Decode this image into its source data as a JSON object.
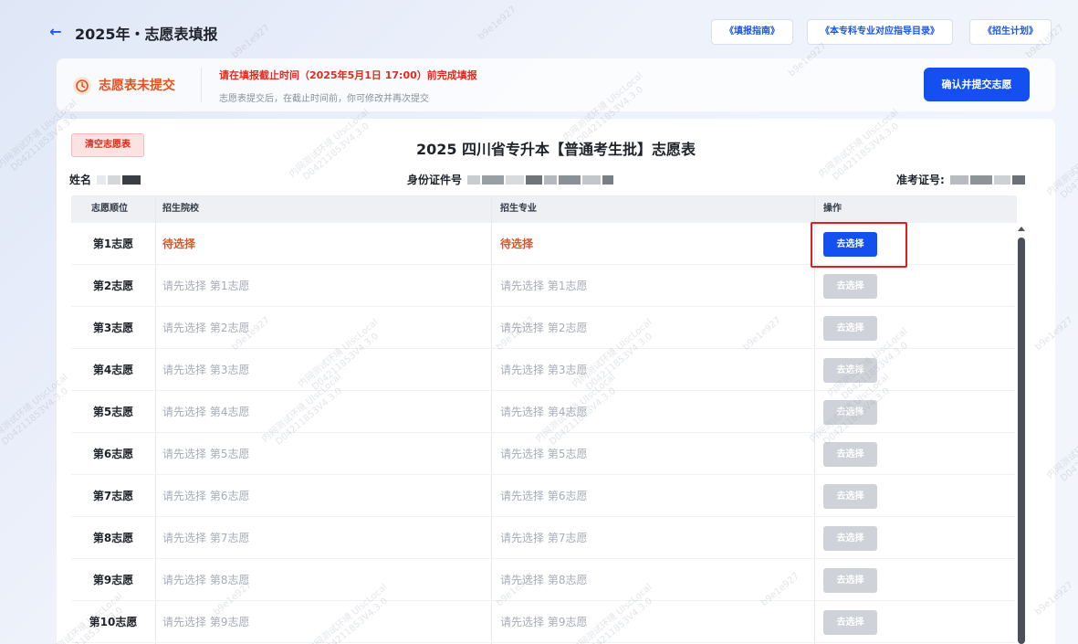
{
  "header": {
    "back_icon": "arrow-left-icon",
    "title": "2025年・志愿表填报",
    "links": [
      "《填报指南》",
      "《本专科专业对应指导目录》",
      "《招生计划》"
    ]
  },
  "status": {
    "icon": "clock-icon",
    "label": "志愿表未提交",
    "deadline": "请在填报截止时间（2025年5月1日 17:00）前完成填报",
    "note": "志愿表提交后，在截止时间前，你可修改并再次提交",
    "submit_label": "确认并提交志愿"
  },
  "form": {
    "clear_label": "清空志愿表",
    "title": "2025 四川省专升本【普通考生批】志愿表",
    "name_label": "姓名",
    "id_label": "身份证件号",
    "exam_label": "准考证号:"
  },
  "table": {
    "headers": [
      "志愿顺位",
      "招生院校",
      "招生专业",
      "操作"
    ],
    "rows": [
      {
        "order": "第1志愿",
        "school": "待选择",
        "major": "待选择",
        "action": "去选择",
        "active": true
      },
      {
        "order": "第2志愿",
        "school": "请先选择 第1志愿",
        "major": "请先选择 第1志愿",
        "action": "去选择",
        "active": false
      },
      {
        "order": "第3志愿",
        "school": "请先选择 第2志愿",
        "major": "请先选择 第2志愿",
        "action": "去选择",
        "active": false
      },
      {
        "order": "第4志愿",
        "school": "请先选择 第3志愿",
        "major": "请先选择 第3志愿",
        "action": "去选择",
        "active": false
      },
      {
        "order": "第5志愿",
        "school": "请先选择 第4志愿",
        "major": "请先选择 第4志愿",
        "action": "去选择",
        "active": false
      },
      {
        "order": "第6志愿",
        "school": "请先选择 第5志愿",
        "major": "请先选择 第5志愿",
        "action": "去选择",
        "active": false
      },
      {
        "order": "第7志愿",
        "school": "请先选择 第6志愿",
        "major": "请先选择 第6志愿",
        "action": "去选择",
        "active": false
      },
      {
        "order": "第8志愿",
        "school": "请先选择 第7志愿",
        "major": "请先选择 第7志愿",
        "action": "去选择",
        "active": false
      },
      {
        "order": "第9志愿",
        "school": "请先选择 第8志愿",
        "major": "请先选择 第8志愿",
        "action": "去选择",
        "active": false
      },
      {
        "order": "第10志愿",
        "school": "请先选择 第9志愿",
        "major": "请先选择 第9志愿",
        "action": "去选择",
        "active": false
      }
    ]
  },
  "watermark": {
    "line1": "内网测试环境 UIscLocal",
    "line2": "D04211853V4.3.0",
    "short": "b9e1e927"
  },
  "colors": {
    "primary": "#1450f0",
    "warning": "#e0531e",
    "danger": "#e02a1b",
    "disabled": "#cfd2d8"
  }
}
